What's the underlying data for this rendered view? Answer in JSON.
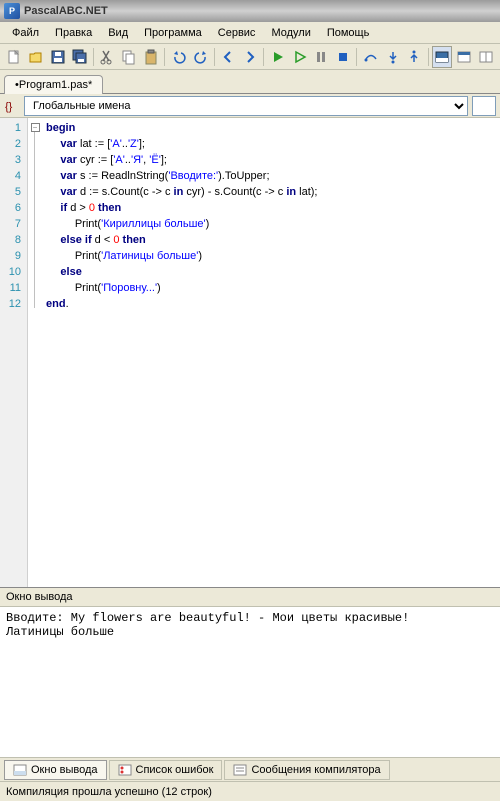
{
  "window": {
    "title": "PascalABC.NET"
  },
  "menu": [
    "Файл",
    "Правка",
    "Вид",
    "Программа",
    "Сервис",
    "Модули",
    "Помощь"
  ],
  "tab": {
    "label": "•Program1.pas*"
  },
  "scope": {
    "selected": "Глобальные имена"
  },
  "code": {
    "lines": [
      1,
      2,
      3,
      4,
      5,
      6,
      7,
      8,
      9,
      10,
      11,
      12
    ]
  },
  "lines_text": {
    "l1_kw": "begin",
    "l2_kw": "var",
    "l2_rest": " lat := [",
    "l2_s1": "'A'",
    "l2_mid": "..",
    "l2_s2": "'Z'",
    "l2_end": "];",
    "l3_kw": "var",
    "l3_rest": " cyr := [",
    "l3_s1": "'А'",
    "l3_m1": "..",
    "l3_s2": "'Я'",
    "l3_m2": ", ",
    "l3_s3": "'Ё'",
    "l3_end": "];",
    "l4_kw": "var",
    "l4_rest": " s := ReadlnString(",
    "l4_s": "'Вводите:'",
    "l4_end": ").ToUpper;",
    "l5_kw": "var",
    "l5_rest": " d := s.Count(c -> c ",
    "l5_in1": "in",
    "l5_m": " cyr) - s.Count(c -> c ",
    "l5_in2": "in",
    "l5_end": " lat);",
    "l6_if": "if",
    "l6_rest": " d > ",
    "l6_n": "0",
    "l6_sp": " ",
    "l6_then": "then",
    "l7_c": "Print(",
    "l7_s": "'Кириллицы больше'",
    "l7_e": ")",
    "l8_else": "else",
    "l8_sp": " ",
    "l8_if": "if",
    "l8_rest": " d < ",
    "l8_n": "0",
    "l8_sp2": " ",
    "l8_then": "then",
    "l9_c": "Print(",
    "l9_s": "'Латиницы больше'",
    "l9_e": ")",
    "l10_else": "else",
    "l11_c": "Print(",
    "l11_s": "'Поровну...'",
    "l11_e": ")",
    "l12_kw": "end",
    "l12_dot": "."
  },
  "output": {
    "title": "Окно вывода",
    "text": "Вводите: My flowers are beautyful! - Мои цветы красивые!\nЛатиницы больше"
  },
  "bottom_tabs": {
    "a": "Окно вывода",
    "b": "Список ошибок",
    "c": "Сообщения компилятора"
  },
  "status": "Компиляция прошла успешно (12 строк)"
}
